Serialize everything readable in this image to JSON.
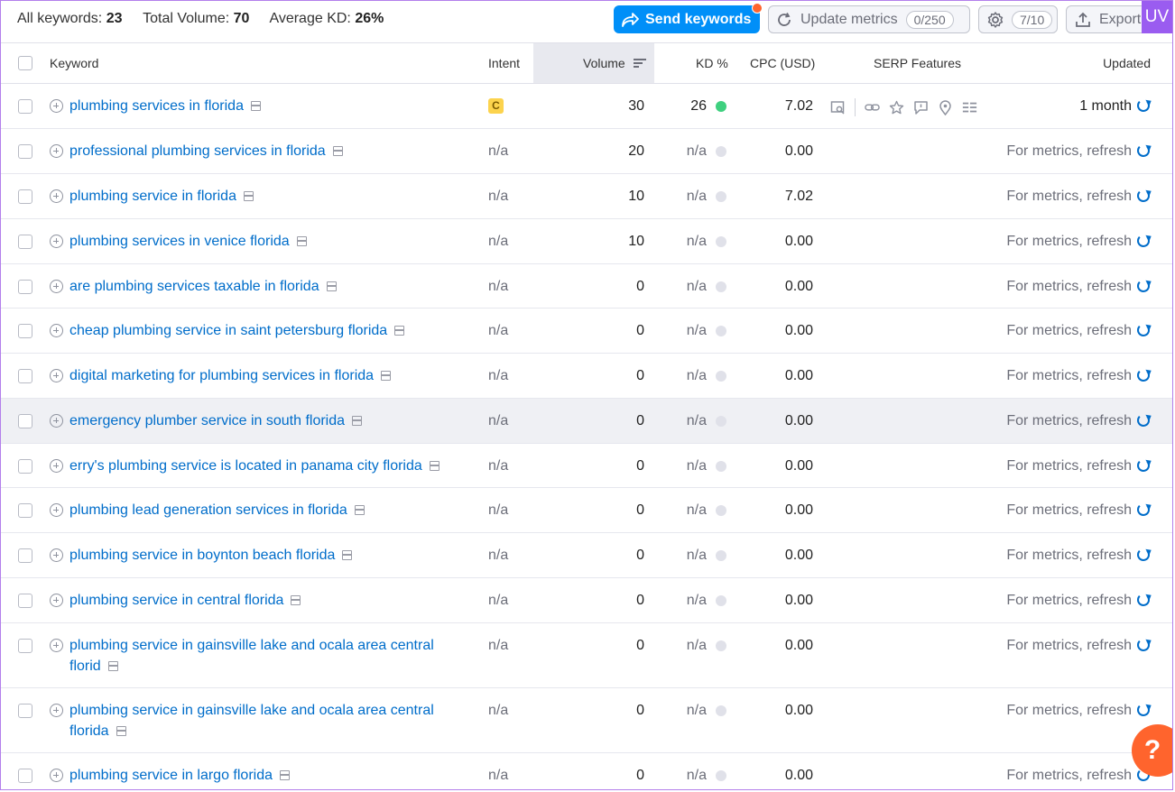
{
  "summary": {
    "all_keywords_label": "All keywords:",
    "all_keywords_value": "23",
    "total_volume_label": "Total Volume:",
    "total_volume_value": "70",
    "avg_kd_label": "Average KD:",
    "avg_kd_value": "26%"
  },
  "toolbar": {
    "send_label": "Send keywords",
    "update_label": "Update metrics",
    "update_count": "0/250",
    "settings_count": "7/10",
    "export_label": "Export"
  },
  "badge": {
    "uv": "UV"
  },
  "columns": {
    "keyword": "Keyword",
    "intent": "Intent",
    "volume": "Volume",
    "kd": "KD %",
    "cpc": "CPC (USD)",
    "serp": "SERP Features",
    "updated": "Updated"
  },
  "rows": [
    {
      "keyword": "plumbing services in florida",
      "intent": "C",
      "volume": "30",
      "kd": "26",
      "cpc": "7.02",
      "updated": "1 month"
    },
    {
      "keyword": "professional plumbing services in florida",
      "intent": "n/a",
      "volume": "20",
      "kd": "n/a",
      "cpc": "0.00",
      "updated": "For metrics, refresh"
    },
    {
      "keyword": "plumbing service in florida",
      "intent": "n/a",
      "volume": "10",
      "kd": "n/a",
      "cpc": "7.02",
      "updated": "For metrics, refresh"
    },
    {
      "keyword": "plumbing services in venice florida",
      "intent": "n/a",
      "volume": "10",
      "kd": "n/a",
      "cpc": "0.00",
      "updated": "For metrics, refresh"
    },
    {
      "keyword": "are plumbing services taxable in florida",
      "intent": "n/a",
      "volume": "0",
      "kd": "n/a",
      "cpc": "0.00",
      "updated": "For metrics, refresh"
    },
    {
      "keyword": "cheap plumbing service in saint petersburg florida",
      "intent": "n/a",
      "volume": "0",
      "kd": "n/a",
      "cpc": "0.00",
      "updated": "For metrics, refresh"
    },
    {
      "keyword": "digital marketing for plumbing services in florida",
      "intent": "n/a",
      "volume": "0",
      "kd": "n/a",
      "cpc": "0.00",
      "updated": "For metrics, refresh"
    },
    {
      "keyword": "emergency plumber service in south florida",
      "intent": "n/a",
      "volume": "0",
      "kd": "n/a",
      "cpc": "0.00",
      "updated": "For metrics, refresh"
    },
    {
      "keyword": "erry's plumbing service is located in panama city florida",
      "intent": "n/a",
      "volume": "0",
      "kd": "n/a",
      "cpc": "0.00",
      "updated": "For metrics, refresh"
    },
    {
      "keyword": "plumbing lead generation services in florida",
      "intent": "n/a",
      "volume": "0",
      "kd": "n/a",
      "cpc": "0.00",
      "updated": "For metrics, refresh"
    },
    {
      "keyword": "plumbing service in boynton beach florida",
      "intent": "n/a",
      "volume": "0",
      "kd": "n/a",
      "cpc": "0.00",
      "updated": "For metrics, refresh"
    },
    {
      "keyword": "plumbing service in central florida",
      "intent": "n/a",
      "volume": "0",
      "kd": "n/a",
      "cpc": "0.00",
      "updated": "For metrics, refresh"
    },
    {
      "keyword": "plumbing service in gainsville lake and ocala area central florid",
      "intent": "n/a",
      "volume": "0",
      "kd": "n/a",
      "cpc": "0.00",
      "updated": "For metrics, refresh"
    },
    {
      "keyword": "plumbing service in gainsville lake and ocala area central florida",
      "intent": "n/a",
      "volume": "0",
      "kd": "n/a",
      "cpc": "0.00",
      "updated": "For metrics, refresh"
    },
    {
      "keyword": "plumbing service in largo florida",
      "intent": "n/a",
      "volume": "0",
      "kd": "n/a",
      "cpc": "0.00",
      "updated": "For metrics, refresh"
    }
  ],
  "colors": {
    "link": "#006dca",
    "accent": "#008ff8",
    "kd_green": "#3fd07f",
    "kd_na": "#e0e1e9",
    "intent_commercial": "#fcd34d",
    "help": "#ff642d"
  },
  "icons": {
    "send": "share-forward-icon",
    "update": "refresh-icon",
    "settings": "gear-icon",
    "export": "upload-icon",
    "sort": "sort-icon",
    "serp": [
      "search-preview-icon",
      "link-icon",
      "star-icon",
      "comment-icon",
      "location-pin-icon",
      "list-icon"
    ],
    "help": "question-icon"
  },
  "help": {
    "label": "?"
  }
}
